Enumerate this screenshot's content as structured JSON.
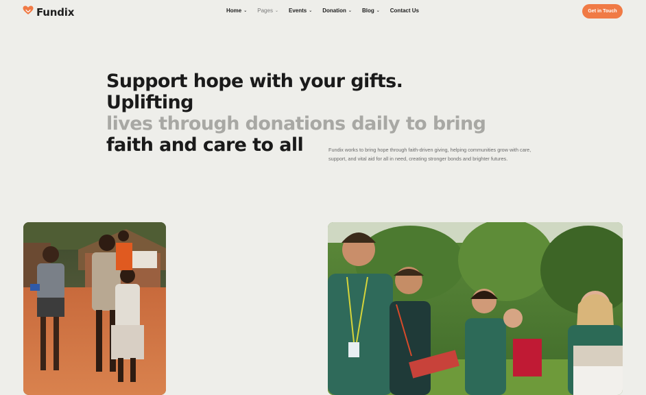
{
  "header": {
    "logo_text": "Fundix",
    "logo_icon": "heart-hand-icon",
    "nav": [
      {
        "label": "Home",
        "dropdown": true,
        "muted": false
      },
      {
        "label": "Pages",
        "dropdown": true,
        "muted": true
      },
      {
        "label": "Events",
        "dropdown": true,
        "muted": false
      },
      {
        "label": "Donation",
        "dropdown": true,
        "muted": false
      },
      {
        "label": "Blog",
        "dropdown": true,
        "muted": false
      },
      {
        "label": "Contact Us",
        "dropdown": false,
        "muted": false
      }
    ],
    "cta_label": "Get in Touch"
  },
  "hero": {
    "line1": "Support hope with your gifts. Uplifting",
    "line2": "lives through donations daily to bring",
    "line3": "faith and care to all",
    "description": "Fundix works to bring hope through faith-driven giving, helping communities grow with care, support, and vital aid for all in need, creating stronger bonds and brighter futures."
  },
  "colors": {
    "background": "#eeeeea",
    "accent": "#f07a45",
    "muted_heading": "#a8a8a4",
    "text": "#1d1d1d"
  }
}
